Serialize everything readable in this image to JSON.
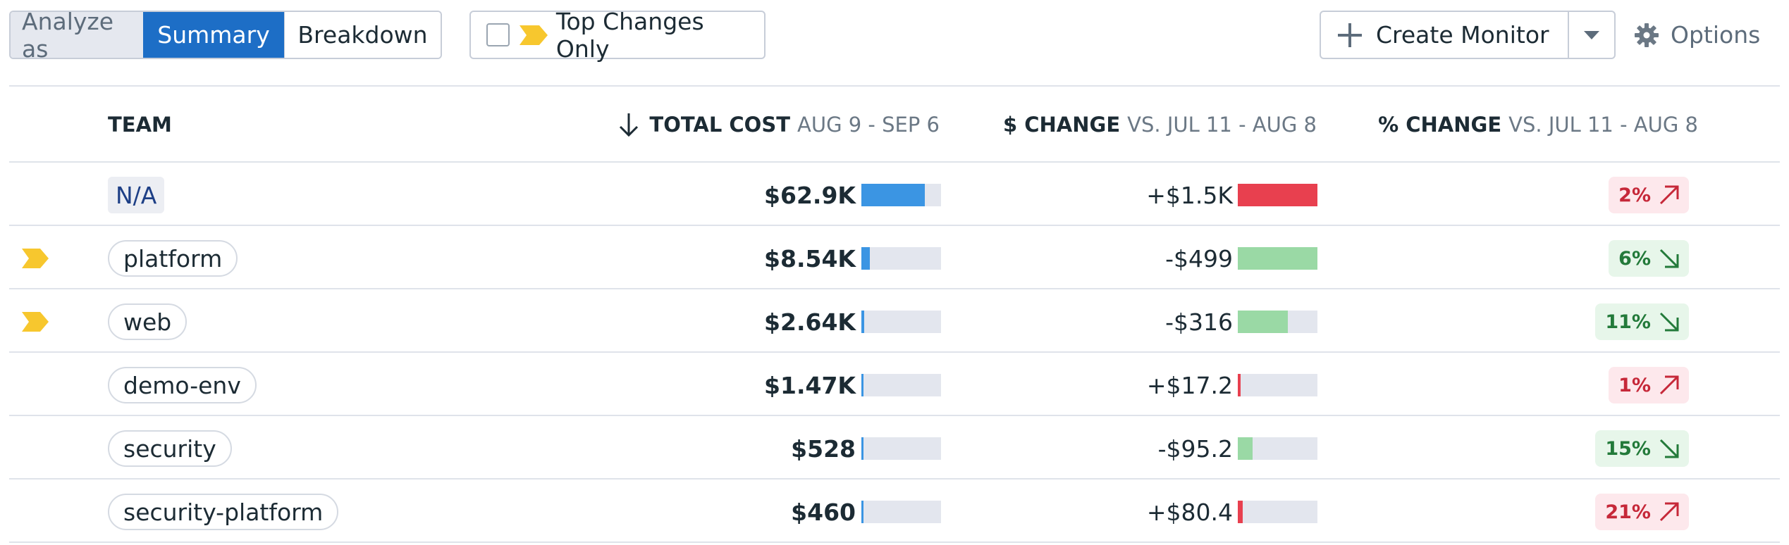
{
  "toolbar": {
    "analyze_label": "Analyze as",
    "summary_label": "Summary",
    "breakdown_label": "Breakdown",
    "top_changes_label": "Top Changes Only",
    "create_monitor_label": "Create Monitor",
    "options_label": "Options"
  },
  "table": {
    "headers": {
      "team": "TEAM",
      "total_cost": "TOTAL COST",
      "total_cost_range": "AUG 9 - SEP 6",
      "dollar_change": "$ CHANGE",
      "dollar_change_range": "VS. JUL 11 - AUG 8",
      "pct_change": "% CHANGE",
      "pct_change_range": "VS. JUL 11 - AUG 8"
    },
    "rows": [
      {
        "team": "N/A",
        "flagged": false,
        "total_cost": "$62.9K",
        "cost_fraction": 0.8,
        "dollar_change": "+$1.5K",
        "change_fraction": 1.0,
        "change_direction": "up",
        "pct_change": "2%"
      },
      {
        "team": "platform",
        "flagged": true,
        "total_cost": "$8.54K",
        "cost_fraction": 0.11,
        "dollar_change": "-$499",
        "change_fraction": 1.0,
        "change_direction": "down",
        "pct_change": "6%"
      },
      {
        "team": "web",
        "flagged": true,
        "total_cost": "$2.64K",
        "cost_fraction": 0.035,
        "dollar_change": "-$316",
        "change_fraction": 0.63,
        "change_direction": "down",
        "pct_change": "11%"
      },
      {
        "team": "demo-env",
        "flagged": false,
        "total_cost": "$1.47K",
        "cost_fraction": 0.02,
        "dollar_change": "+$17.2",
        "change_fraction": 0.035,
        "change_direction": "up",
        "pct_change": "1%"
      },
      {
        "team": "security",
        "flagged": false,
        "total_cost": "$528",
        "cost_fraction": 0.01,
        "dollar_change": "-$95.2",
        "change_fraction": 0.19,
        "change_direction": "down",
        "pct_change": "15%"
      },
      {
        "team": "security-platform",
        "flagged": false,
        "total_cost": "$460",
        "cost_fraction": 0.01,
        "dollar_change": "+$80.4",
        "change_fraction": 0.06,
        "change_direction": "up",
        "pct_change": "21%"
      }
    ]
  },
  "colors": {
    "accent": "#1d6ec6",
    "cost_bar": "#3b95e3",
    "increase": "#e8404f",
    "decrease": "#9ad9a5",
    "flag": "#f7c72e"
  }
}
